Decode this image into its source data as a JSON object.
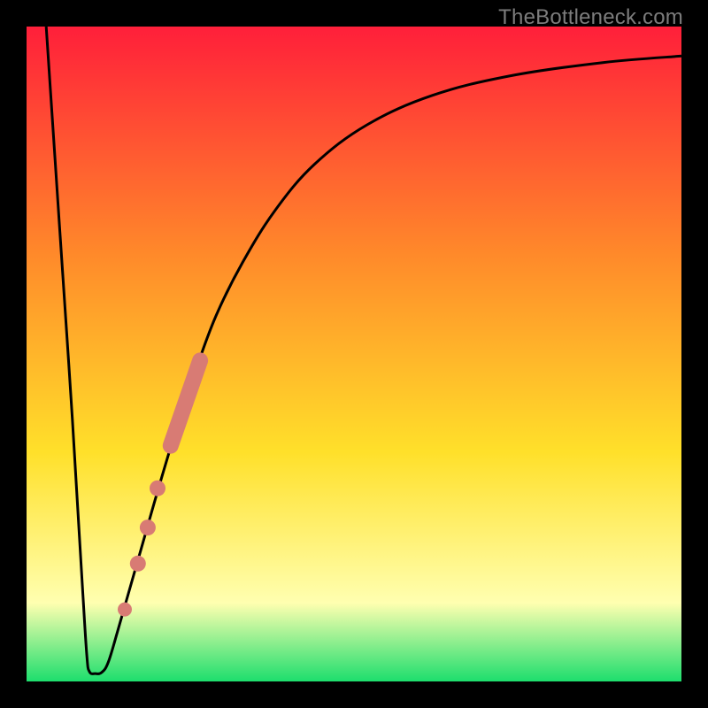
{
  "watermark": "TheBottleneck.com",
  "chart_data": {
    "type": "line",
    "title": "",
    "xlabel": "",
    "ylabel": "",
    "xlim": [
      0,
      100
    ],
    "ylim": [
      0,
      100
    ],
    "gradient_colors": {
      "top": "#ff1f3a",
      "mid1": "#ff8a2a",
      "mid2": "#ffe02a",
      "pale": "#ffffb0",
      "bottom": "#1dde6d"
    },
    "series": [
      {
        "name": "bottleneck-curve",
        "color": "#000000",
        "points": [
          {
            "x": 3.0,
            "y": 100.0
          },
          {
            "x": 5.0,
            "y": 70.0
          },
          {
            "x": 7.0,
            "y": 40.0
          },
          {
            "x": 8.5,
            "y": 15.0
          },
          {
            "x": 9.2,
            "y": 4.0
          },
          {
            "x": 9.6,
            "y": 1.5
          },
          {
            "x": 10.5,
            "y": 1.2
          },
          {
            "x": 11.5,
            "y": 1.4
          },
          {
            "x": 12.5,
            "y": 3.0
          },
          {
            "x": 14.0,
            "y": 8.0
          },
          {
            "x": 16.0,
            "y": 15.0
          },
          {
            "x": 18.0,
            "y": 22.0
          },
          {
            "x": 20.0,
            "y": 29.0
          },
          {
            "x": 23.0,
            "y": 39.0
          },
          {
            "x": 26.0,
            "y": 48.0
          },
          {
            "x": 29.0,
            "y": 56.0
          },
          {
            "x": 33.0,
            "y": 64.0
          },
          {
            "x": 38.0,
            "y": 72.0
          },
          {
            "x": 44.0,
            "y": 79.0
          },
          {
            "x": 52.0,
            "y": 85.0
          },
          {
            "x": 62.0,
            "y": 89.5
          },
          {
            "x": 74.0,
            "y": 92.5
          },
          {
            "x": 88.0,
            "y": 94.5
          },
          {
            "x": 100.0,
            "y": 95.5
          }
        ]
      },
      {
        "name": "highlighted-range-bar",
        "color": "#d87b74",
        "type": "scatter",
        "points": [
          {
            "x": 22.0,
            "y": 36.0
          },
          {
            "x": 26.5,
            "y": 49.0
          }
        ]
      },
      {
        "name": "highlighted-dots",
        "color": "#d87b74",
        "type": "scatter",
        "points": [
          {
            "x": 15.0,
            "y": 11.0
          },
          {
            "x": 17.0,
            "y": 18.0
          },
          {
            "x": 18.5,
            "y": 23.5
          },
          {
            "x": 20.0,
            "y": 29.5
          }
        ]
      }
    ]
  }
}
